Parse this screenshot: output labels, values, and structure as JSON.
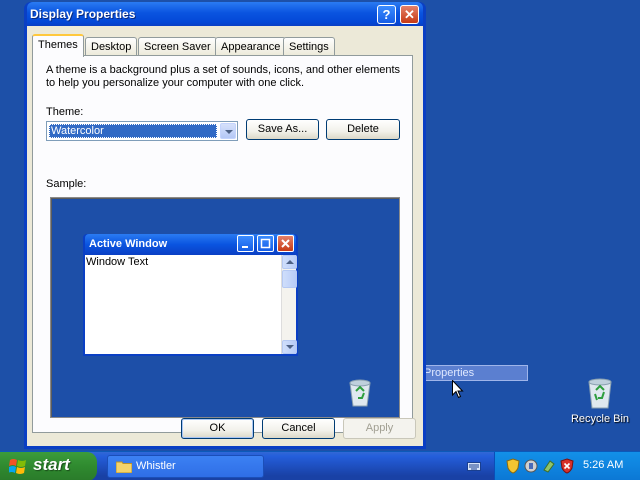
{
  "dialog": {
    "title": "Display Properties",
    "tabs": [
      {
        "label": "Themes"
      },
      {
        "label": "Desktop"
      },
      {
        "label": "Screen Saver"
      },
      {
        "label": "Appearance"
      },
      {
        "label": "Settings"
      }
    ],
    "description": "A theme is a background plus a set of sounds, icons, and other elements to help you personalize your computer with one click.",
    "theme_label": "Theme:",
    "theme_value": "Watercolor",
    "save_as_label": "Save As...",
    "delete_label": "Delete",
    "sample_label": "Sample:",
    "sample": {
      "window_title": "Active Window",
      "window_text": "Window Text"
    },
    "ok_label": "OK",
    "cancel_label": "Cancel",
    "apply_label": "Apply"
  },
  "desktop": {
    "recycle_bin_label": "Recycle Bin",
    "drag_label": "Properties"
  },
  "taskbar": {
    "start_label": "start",
    "task_label": "Whistler",
    "clock": "5:26 AM"
  },
  "colors": {
    "desktop": "#1d50a8",
    "titlebar": "#0a54e0",
    "dialog_face": "#ece9d8",
    "selection": "#316ac5",
    "start_green": "#2f8a2f",
    "tray": "#0f84df"
  }
}
